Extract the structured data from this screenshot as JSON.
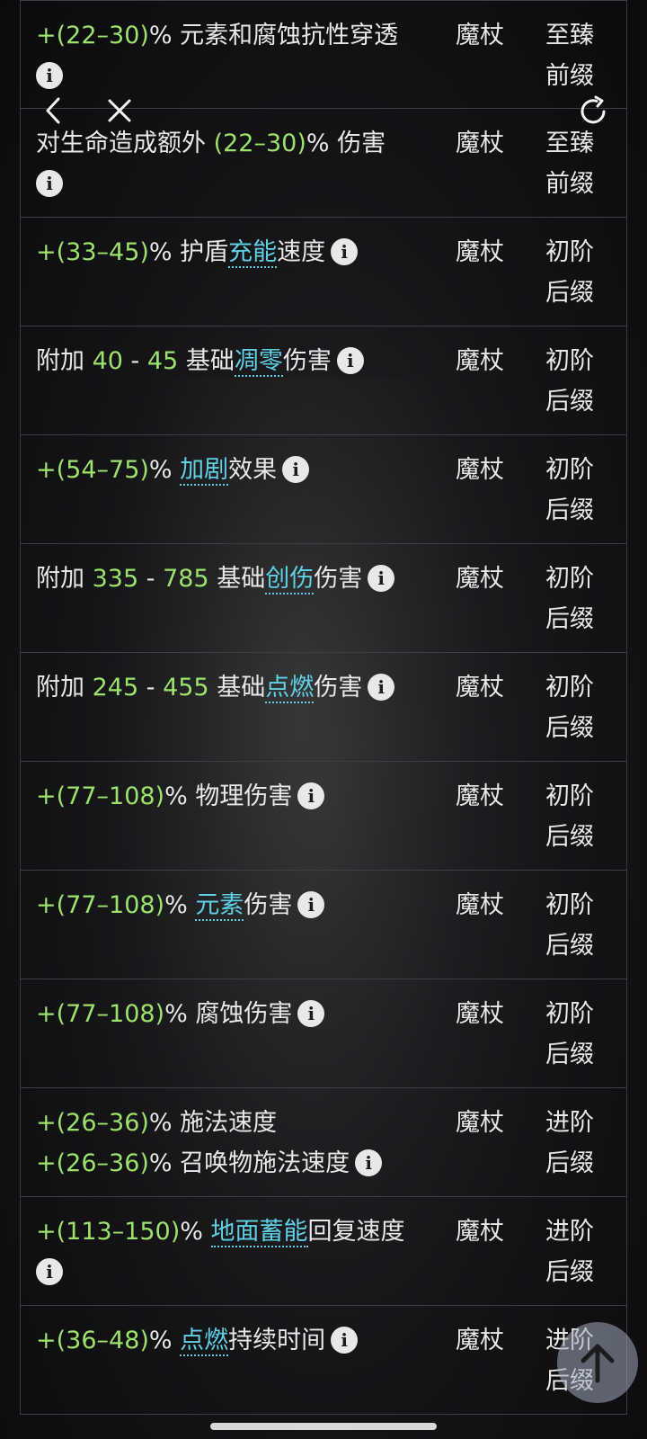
{
  "rows": [
    {
      "mod_html": "<span class='g'>+(22–30)</span>% 元素和腐蚀抗性穿透",
      "info_break": true,
      "type": "魔杖",
      "tier_line1": "至臻",
      "tier_line2": "前缀"
    },
    {
      "mod_html": "对生命造成额外 <span class='g'>(22–30)</span>% 伤害",
      "info_break": true,
      "type": "魔杖",
      "tier_line1": "至臻",
      "tier_line2": "前缀"
    },
    {
      "mod_html": "<span class='g'>+(33–45)</span>% 护盾<span class='kw'>充能</span>速度",
      "info_break": false,
      "type": "魔杖",
      "tier_line1": "初阶",
      "tier_line2": "后缀"
    },
    {
      "mod_html": "附加 <span class='g'>40</span> - <span class='g'>45</span> 基础<span class='kw'>凋零</span>伤害",
      "info_break": false,
      "type": "魔杖",
      "tier_line1": "初阶",
      "tier_line2": "后缀"
    },
    {
      "mod_html": "<span class='g'>+(54–75)</span>% <span class='kw'>加剧</span>效果",
      "info_break": false,
      "type": "魔杖",
      "tier_line1": "初阶",
      "tier_line2": "后缀"
    },
    {
      "mod_html": "附加 <span class='g'>335</span> - <span class='g'>785</span> 基础<span class='kw'>创伤</span>伤害",
      "info_break": false,
      "type": "魔杖",
      "tier_line1": "初阶",
      "tier_line2": "后缀"
    },
    {
      "mod_html": "附加 <span class='g'>245</span> - <span class='g'>455</span> 基础<span class='kw'>点燃</span>伤害",
      "info_break": false,
      "type": "魔杖",
      "tier_line1": "初阶",
      "tier_line2": "后缀"
    },
    {
      "mod_html": "<span class='g'>+(77–108)</span>% 物理伤害",
      "info_break": false,
      "type": "魔杖",
      "tier_line1": "初阶",
      "tier_line2": "后缀"
    },
    {
      "mod_html": "<span class='g'>+(77–108)</span>% <span class='kw'>元素</span>伤害",
      "info_break": false,
      "type": "魔杖",
      "tier_line1": "初阶",
      "tier_line2": "后缀"
    },
    {
      "mod_html": "<span class='g'>+(77–108)</span>% 腐蚀伤害",
      "info_break": false,
      "type": "魔杖",
      "tier_line1": "初阶",
      "tier_line2": "后缀"
    },
    {
      "mod_html": "<span class='g'>+(26–36)</span>% 施法速度<br><span class='g'>+(26–36)</span>% 召唤物施法速度",
      "info_break": false,
      "type": "魔杖",
      "tier_line1": "进阶",
      "tier_line2": "后缀"
    },
    {
      "mod_html": "<span class='g'>+(113–150)</span>% <span class='kw'>地面蓄能</span>回复速度",
      "info_break": true,
      "type": "魔杖",
      "tier_line1": "进阶",
      "tier_line2": "后缀"
    },
    {
      "mod_html": "<span class='g'>+(36–48)</span>% <span class='kw'>点燃</span>持续时间",
      "info_break": false,
      "type": "魔杖",
      "tier_line1": "进阶",
      "tier_line2": "后缀"
    }
  ],
  "icons": {
    "back": "chevron-left-icon",
    "close": "close-icon",
    "refresh": "refresh-icon",
    "info": "info-icon",
    "scroll_top": "arrow-up-icon"
  },
  "info_glyph": "i",
  "colors": {
    "value_green": "#9be36a",
    "keyword_cyan": "#5fd0e6",
    "text": "#e8e8e8"
  }
}
